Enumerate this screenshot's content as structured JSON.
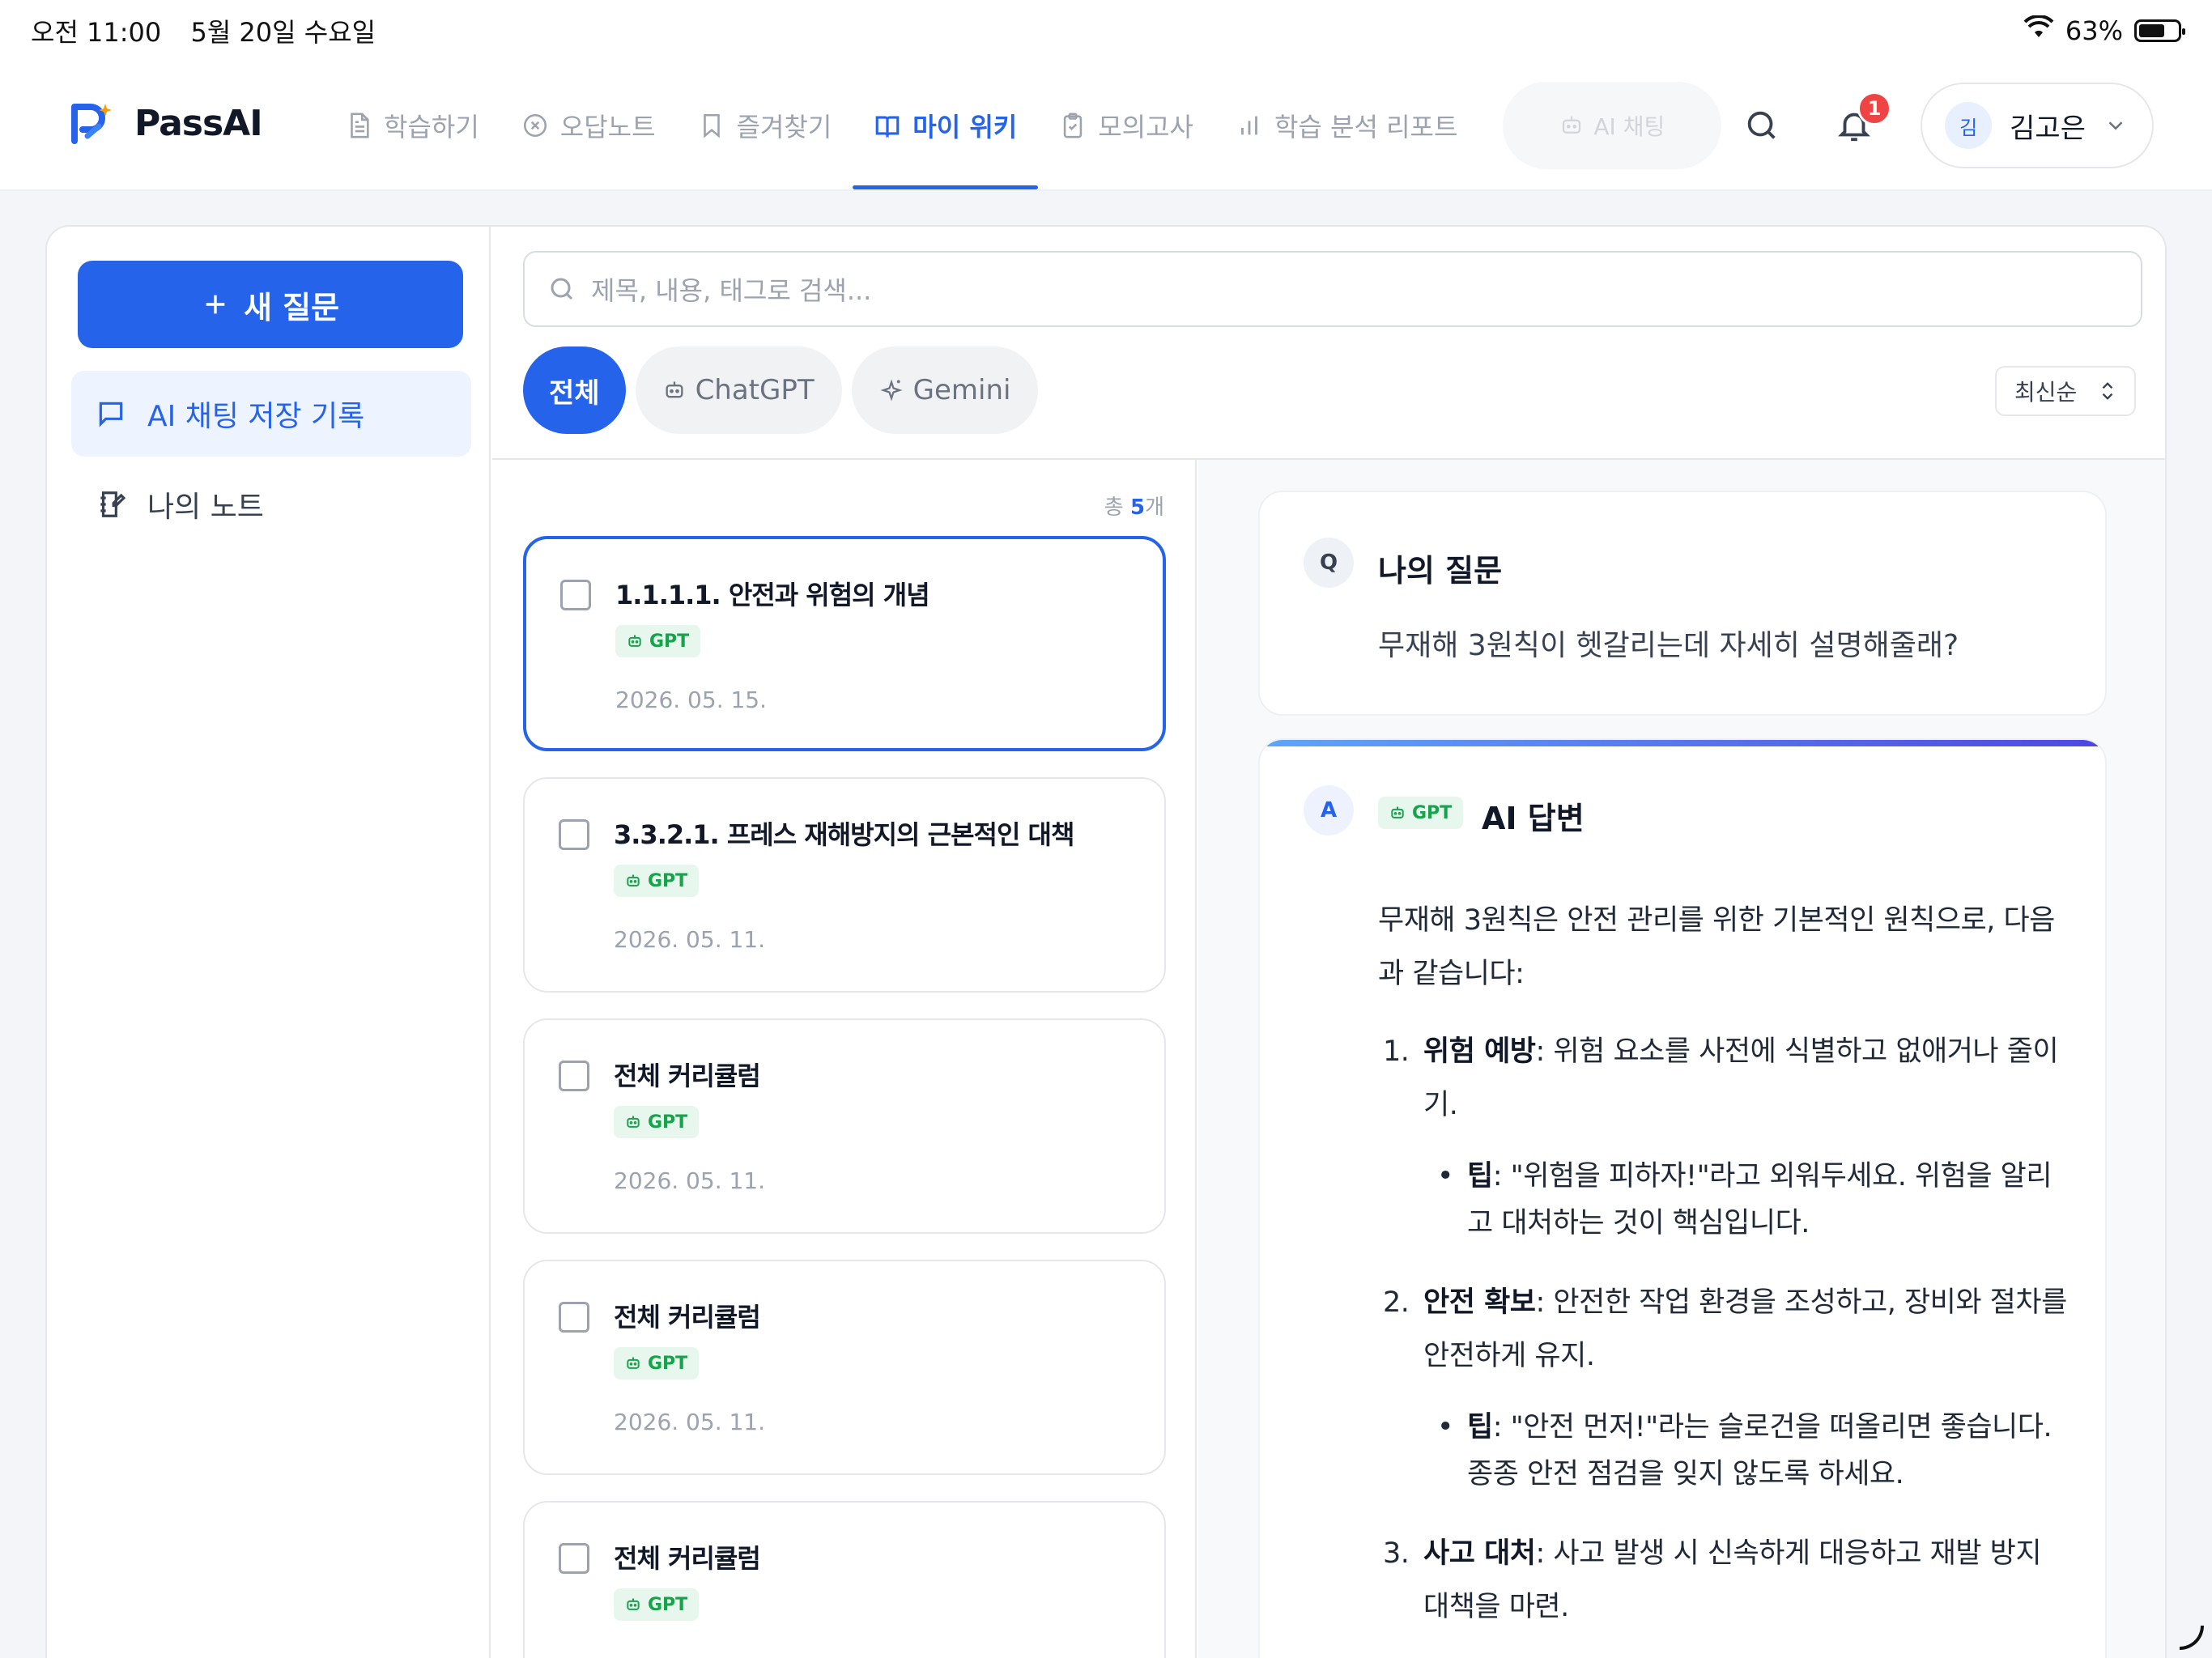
{
  "status_bar": {
    "time": "오전 11:00",
    "date": "5월 20일 수요일",
    "battery": "63%"
  },
  "brand": {
    "name": "PassAI"
  },
  "nav": {
    "items": [
      {
        "label": "학습하기",
        "icon": "document-icon"
      },
      {
        "label": "오답노트",
        "icon": "x-circle-icon"
      },
      {
        "label": "즐겨찾기",
        "icon": "bookmark-icon"
      },
      {
        "label": "마이 위키",
        "icon": "book-icon",
        "active": true
      },
      {
        "label": "모의고사",
        "icon": "clipboard-icon"
      },
      {
        "label": "학습 분석 리포트",
        "icon": "bar-chart-icon"
      }
    ],
    "ai_chat": "AI 채팅",
    "notification_count": "1",
    "user": {
      "avatar": "김",
      "name": "김고은"
    }
  },
  "sidebar": {
    "new_question": "새 질문",
    "items": [
      {
        "label": "AI 채팅 저장 기록",
        "active": true
      },
      {
        "label": "나의 노트"
      }
    ]
  },
  "search": {
    "placeholder": "제목, 내용, 태그로 검색..."
  },
  "filters": {
    "all": "전체",
    "chatgpt": "ChatGPT",
    "gemini": "Gemini"
  },
  "sort": {
    "selected": "최신순"
  },
  "list": {
    "total_prefix": "총 ",
    "total_count": "5",
    "total_suffix": "개",
    "cards": [
      {
        "title": "1.1.1.1. 안전과 위험의 개념",
        "tag": "GPT",
        "date": "2026. 05. 15."
      },
      {
        "title": "3.3.2.1. 프레스 재해방지의 근본적인 대책",
        "tag": "GPT",
        "date": "2026. 05. 11."
      },
      {
        "title": "전체 커리큘럼",
        "tag": "GPT",
        "date": "2026. 05. 11."
      },
      {
        "title": "전체 커리큘럼",
        "tag": "GPT",
        "date": "2026. 05. 11."
      },
      {
        "title": "전체 커리큘럼",
        "tag": "GPT",
        "date": ""
      }
    ]
  },
  "detail": {
    "question": {
      "badge": "Q",
      "title": "나의 질문",
      "text": "무재해 3원칙이 헷갈리는데 자세히 설명해줄래?"
    },
    "answer": {
      "badge": "A",
      "tag": "GPT",
      "title": "AI 답변",
      "intro": "무재해 3원칙은 안전 관리를 위한 기본적인 원칙으로, 다음과 같습니다:",
      "items": [
        {
          "num": "1.",
          "term": "위험 예방",
          "desc": ": 위험 요소를 사전에 식별하고 없애거나 줄이기.",
          "tip_label": "팁",
          "tip": ": \"위험을 피하자!\"라고 외워두세요. 위험을 알리고 대처하는 것이 핵심입니다."
        },
        {
          "num": "2.",
          "term": "안전 확보",
          "desc": ": 안전한 작업 환경을 조성하고, 장비와 절차를 안전하게 유지.",
          "tip_label": "팁",
          "tip": ": \"안전 먼저!\"라는 슬로건을 떠올리면 좋습니다. 종종 안전 점검을 잊지 않도록 하세요."
        },
        {
          "num": "3.",
          "term": "사고 대처",
          "desc": ": 사고 발생 시 신속하게 대응하고 재발 방지 대책을 마련."
        }
      ]
    }
  },
  "colors": {
    "accent": "#2563eb",
    "gpt_tag_bg": "#e8f7ee",
    "gpt_tag_text": "#16a34a",
    "badge": "#ef4444"
  }
}
